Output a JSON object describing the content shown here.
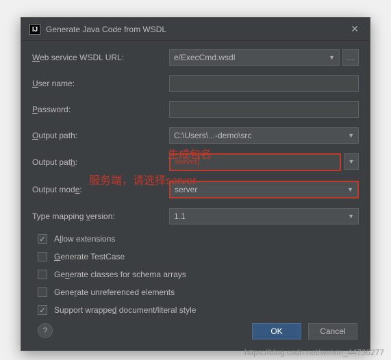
{
  "dialog": {
    "title": "Generate Java Code from WSDL",
    "icon_text": "IJ"
  },
  "fields": {
    "wsdl_url_label": "Web service WSDL URL:",
    "wsdl_url_value": "e/ExecCmd.wsdl",
    "username_label": "User name:",
    "username_value": "",
    "password_label": "Password:",
    "password_value": "",
    "output_path1_label": "Output path:",
    "output_path1_value": "C:\\Users\\...-demo\\src",
    "output_path2_label": "Output path:",
    "output_path2_value": "server",
    "output_mode_label": "Output mode:",
    "output_mode_value": "server",
    "type_mapping_label": "Type mapping version:",
    "type_mapping_value": "1.1"
  },
  "checks": {
    "allow_extensions": {
      "label": "Allow extensions",
      "checked": true
    },
    "generate_testcase": {
      "label": "Generate TestCase",
      "checked": false
    },
    "generate_schema": {
      "label": "Generate classes for schema arrays",
      "checked": false
    },
    "generate_unref": {
      "label": "Generate unreferenced elements",
      "checked": false
    },
    "support_wrapped": {
      "label": "Support wrapped document/literal style",
      "checked": true
    }
  },
  "buttons": {
    "ok": "OK",
    "cancel": "Cancel",
    "help": "?"
  },
  "annotations": {
    "gen_package": "生成包名",
    "server_side": "服务端，请选择server"
  },
  "watermark": "https://blog.csdn.net/weixin_44736277"
}
